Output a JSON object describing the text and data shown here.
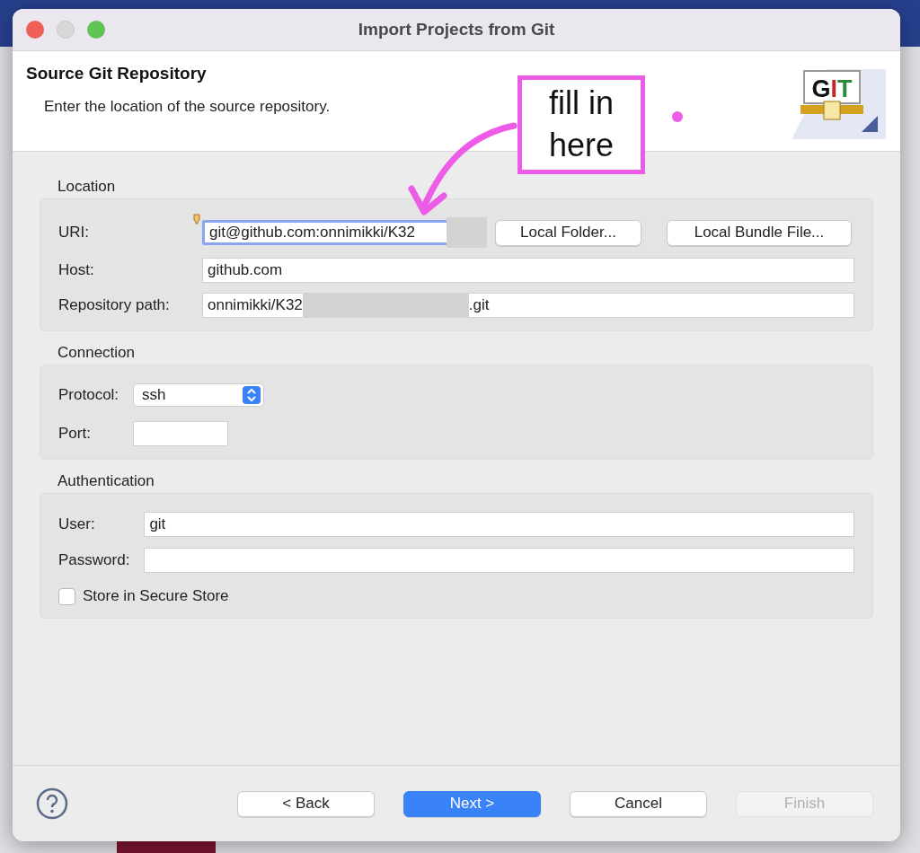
{
  "window": {
    "title": "Import Projects from Git"
  },
  "header": {
    "title": "Source Git Repository",
    "description": "Enter the location of the source repository.",
    "logo_letters": [
      {
        "char": "G",
        "color": "#111111"
      },
      {
        "char": "I",
        "color": "#c0282a"
      },
      {
        "char": "T",
        "color": "#2a8a3a"
      }
    ]
  },
  "annotation": {
    "text": "fill in here"
  },
  "groups": [
    {
      "title": "Location",
      "rows": [
        {
          "kind": "text",
          "label": "URI:",
          "value": "git@github.com:onnimikki/K32",
          "focused": true,
          "redacted": true,
          "buttons": [
            "Local Folder...",
            "Local Bundle File..."
          ]
        },
        {
          "kind": "text",
          "label": "Host:",
          "value": "github.com"
        },
        {
          "kind": "text",
          "label": "Repository path:",
          "value": "onnimikki/K32",
          "redacted": true,
          "value_end": ".git"
        }
      ]
    },
    {
      "title": "Connection",
      "rows": [
        {
          "kind": "select",
          "label": "Protocol:",
          "value": "ssh"
        },
        {
          "kind": "short",
          "label": "Port:"
        }
      ]
    },
    {
      "title": "Authentication",
      "rows": [
        {
          "kind": "text",
          "label": "User:",
          "value": "git"
        },
        {
          "kind": "text",
          "label": "Password:"
        },
        {
          "kind": "checkbox",
          "label": "Store in Secure Store",
          "checked": false
        }
      ]
    }
  ],
  "buttons": [
    {
      "label": "< Back",
      "default": false,
      "disabled": false
    },
    {
      "label": "Next >",
      "default": true,
      "disabled": false
    },
    {
      "label": "Cancel",
      "default": false,
      "disabled": false
    },
    {
      "label": "Finish",
      "default": false,
      "disabled": true
    }
  ]
}
